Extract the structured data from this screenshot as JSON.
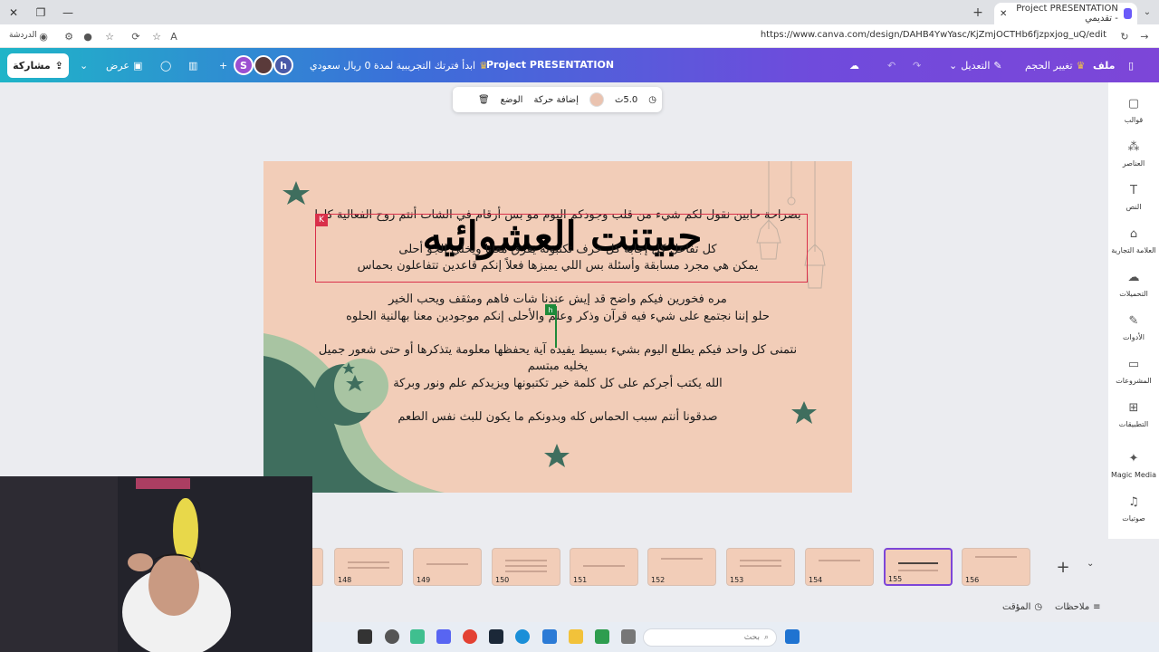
{
  "browser": {
    "tab_title": "Project PRESENTATION - تقديمي",
    "url": "https://www.canva.com/design/DAHB4YwYasc/KjZmjOCTHb6fjzpxjog_uQ/edit",
    "profile_label": "الدردشة"
  },
  "header": {
    "share_label": "مشاركة",
    "present_label": "عرض",
    "trial_label": "ابدأ فترتك التجريبية لمدة 0 ريال سعودي",
    "project_title": "Project PRESENTATION",
    "edit_label": "التعديل",
    "resize_label": "تغيير الحجم",
    "file_label": "ملف",
    "avatars": [
      "S",
      "h"
    ]
  },
  "toolbar": {
    "duration": "5.0ث",
    "animate_label": "إضافة حركة",
    "position_label": "الوضع"
  },
  "slide": {
    "title": "حبيتنت العشوائيه",
    "lines": [
      "بصراحة حابين نقول لكم شيء من قلب وجودكم اليوم مو بس أرقام في الشات أنتم روح الفعالية كلها",
      "كل تفاعل كل إجابه كل حرف تكتبونه يفرق معانا ويخلي الجو أحلى",
      "يمكن هي مجرد مسابقة وأسئلة بس اللي يميزها فعلاً إنكم قاعدين تتفاعلون بحماس",
      "مره فخورين فيكم واضح قد إيش عندنا شات فاهم ومثقف ويحب الخير",
      "حلو إننا نجتمع على شيء فيه قرآن وذكر وعلم والأحلى إنكم موجودين معنا بهالنية الحلوه",
      "نتمنى كل واحد فيكم يطلع اليوم بشيء بسيط يفيده آية يحفظها معلومة يتذكرها أو حتى شعور جميل",
      "يخليه مبتسم",
      "الله يكتب أجركم على كل كلمة خير تكتبونها ويزيدكم علم ونور وبركة",
      "صدقونا أنتم سبب الحماس كله وبدونكم ما يكون للبث نفس الطعم"
    ],
    "selection_badges": [
      "K",
      "h"
    ]
  },
  "sidebar": {
    "items": [
      {
        "label": "قوالب",
        "icon": "templates-icon"
      },
      {
        "label": "العناصر",
        "icon": "elements-icon"
      },
      {
        "label": "النص",
        "icon": "text-icon"
      },
      {
        "label": "العلامة التجارية",
        "icon": "brand-icon"
      },
      {
        "label": "التحميلات",
        "icon": "uploads-icon"
      },
      {
        "label": "الأدوات",
        "icon": "tools-icon"
      },
      {
        "label": "المشروعات",
        "icon": "projects-icon"
      },
      {
        "label": "التطبيقات",
        "icon": "apps-icon"
      },
      {
        "label": "Magic Media",
        "icon": "magic-media-icon"
      },
      {
        "label": "صوتيات",
        "icon": "audio-icon"
      }
    ]
  },
  "pages": {
    "numbers": [
      "148",
      "149",
      "150",
      "151",
      "152",
      "153",
      "154",
      "155",
      "156"
    ],
    "active": "155"
  },
  "footer": {
    "notes_label": "ملاحظات",
    "timer_label": "المؤقت"
  },
  "taskbar": {
    "search_placeholder": "بحث"
  }
}
